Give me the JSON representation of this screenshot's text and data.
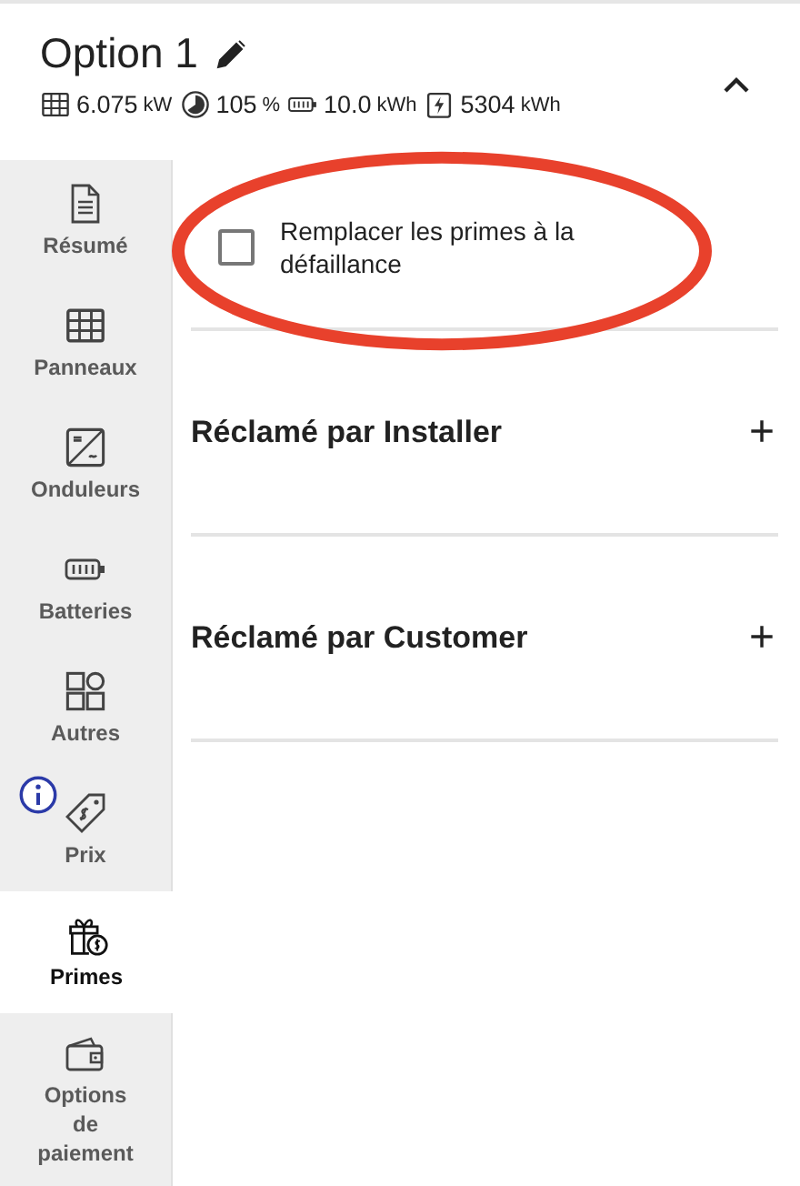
{
  "header": {
    "title": "Option 1",
    "expanded": true,
    "stats": [
      {
        "kind": "panels",
        "value": "6.075",
        "unit": "kW"
      },
      {
        "kind": "ratio",
        "value": "105",
        "unit": "%"
      },
      {
        "kind": "battery",
        "value": "10.0",
        "unit": "kWh"
      },
      {
        "kind": "production",
        "value": "5304",
        "unit": "kWh"
      }
    ]
  },
  "sidebar": {
    "items": [
      {
        "kind": "summary",
        "label": "Résumé",
        "selected": false,
        "info": false
      },
      {
        "kind": "panels",
        "label": "Panneaux",
        "selected": false,
        "info": false
      },
      {
        "kind": "inverter",
        "label": "Onduleurs",
        "selected": false,
        "info": false
      },
      {
        "kind": "battery",
        "label": "Batteries",
        "selected": false,
        "info": false
      },
      {
        "kind": "other",
        "label": "Autres",
        "selected": false,
        "info": false
      },
      {
        "kind": "price",
        "label": "Prix",
        "selected": false,
        "info": true
      },
      {
        "kind": "gift",
        "label": "Primes",
        "selected": true,
        "info": false
      },
      {
        "kind": "wallet",
        "label": "Options de paiement",
        "selected": false,
        "info": false
      }
    ]
  },
  "content": {
    "checkbox": {
      "label": "Remplacer les primes à la défaillance",
      "checked": false,
      "highlighted": true
    },
    "sections": [
      {
        "title": "Réclamé par Installer",
        "toggle": "+"
      },
      {
        "title": "Réclamé par Customer",
        "toggle": "+"
      }
    ]
  }
}
